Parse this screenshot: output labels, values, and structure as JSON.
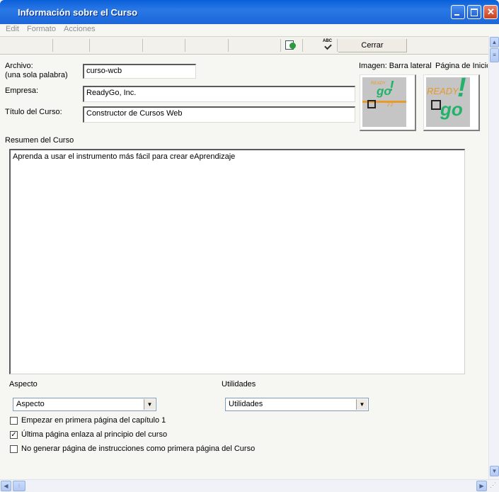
{
  "window": {
    "title": "Información sobre el Curso"
  },
  "menu": [
    "Edit",
    "Formato",
    "Acciones"
  ],
  "toolbar": {
    "close_label": "Cerrar",
    "abc_label": "ABC"
  },
  "form": {
    "archivo_label": "Archivo:",
    "archivo_sub": "(una sola palabra)",
    "archivo_value": "curso-wcb",
    "empresa_label": "Empresa:",
    "empresa_value": "ReadyGo, Inc.",
    "titulo_label": "Título del Curso:",
    "titulo_value": "Constructor de Cursos Web",
    "image_sidebar_label": "Imagen: Barra lateral",
    "image_home_label": "Página de Inicio",
    "resumen_label": "Resumen del Curso",
    "resumen_value": "Aprenda a usar el instrumento más fácil para crear eAprendizaje",
    "aspecto_label": "Aspecto",
    "aspecto_value": "Aspecto",
    "utilidades_label": "Utilidades",
    "utilidades_value": "Utilidades",
    "logo_text_small": "READY",
    "logo_text_go": "go"
  },
  "checkboxes": [
    {
      "label": "Empezar en primera página del capítulo 1",
      "checked": false
    },
    {
      "label": "Última página enlaza al principio del curso",
      "checked": true
    },
    {
      "label": "No generar página de instrucciones como primera página del Curso",
      "checked": false
    }
  ]
}
